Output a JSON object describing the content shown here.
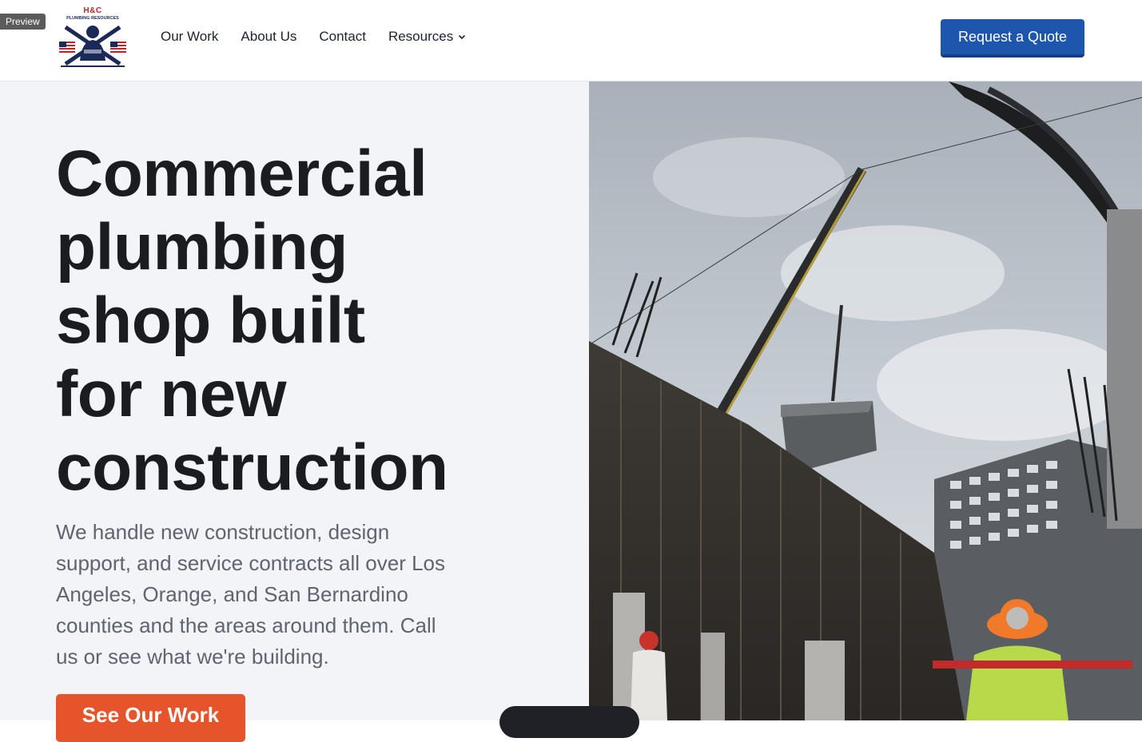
{
  "preview_label": "Preview",
  "logo": {
    "brand": "H&C",
    "subtitle": "PLUMBING RESOURCES"
  },
  "nav": {
    "items": [
      {
        "label": "Our Work"
      },
      {
        "label": "About Us"
      },
      {
        "label": "Contact"
      },
      {
        "label": "Resources",
        "icon": "chevron-down-icon"
      }
    ]
  },
  "header": {
    "quote_button": "Request a Quote"
  },
  "hero": {
    "title_lines": [
      "Commercial",
      "plumbing",
      "shop built",
      "for new",
      "construction"
    ],
    "description_lines": [
      "We handle new construction, design",
      "support, and service contracts all over Los",
      "Angeles, Orange, and San Bernardino",
      "counties and the areas around them. Call",
      "us or see what we're building."
    ],
    "cta_label": "See Our Work"
  },
  "colors": {
    "brand_blue": "#1e56ad",
    "cta_orange": "#e5542b",
    "hero_bg": "#f3f4f7",
    "title": "#1a1c20",
    "body_text": "#5f6470"
  }
}
